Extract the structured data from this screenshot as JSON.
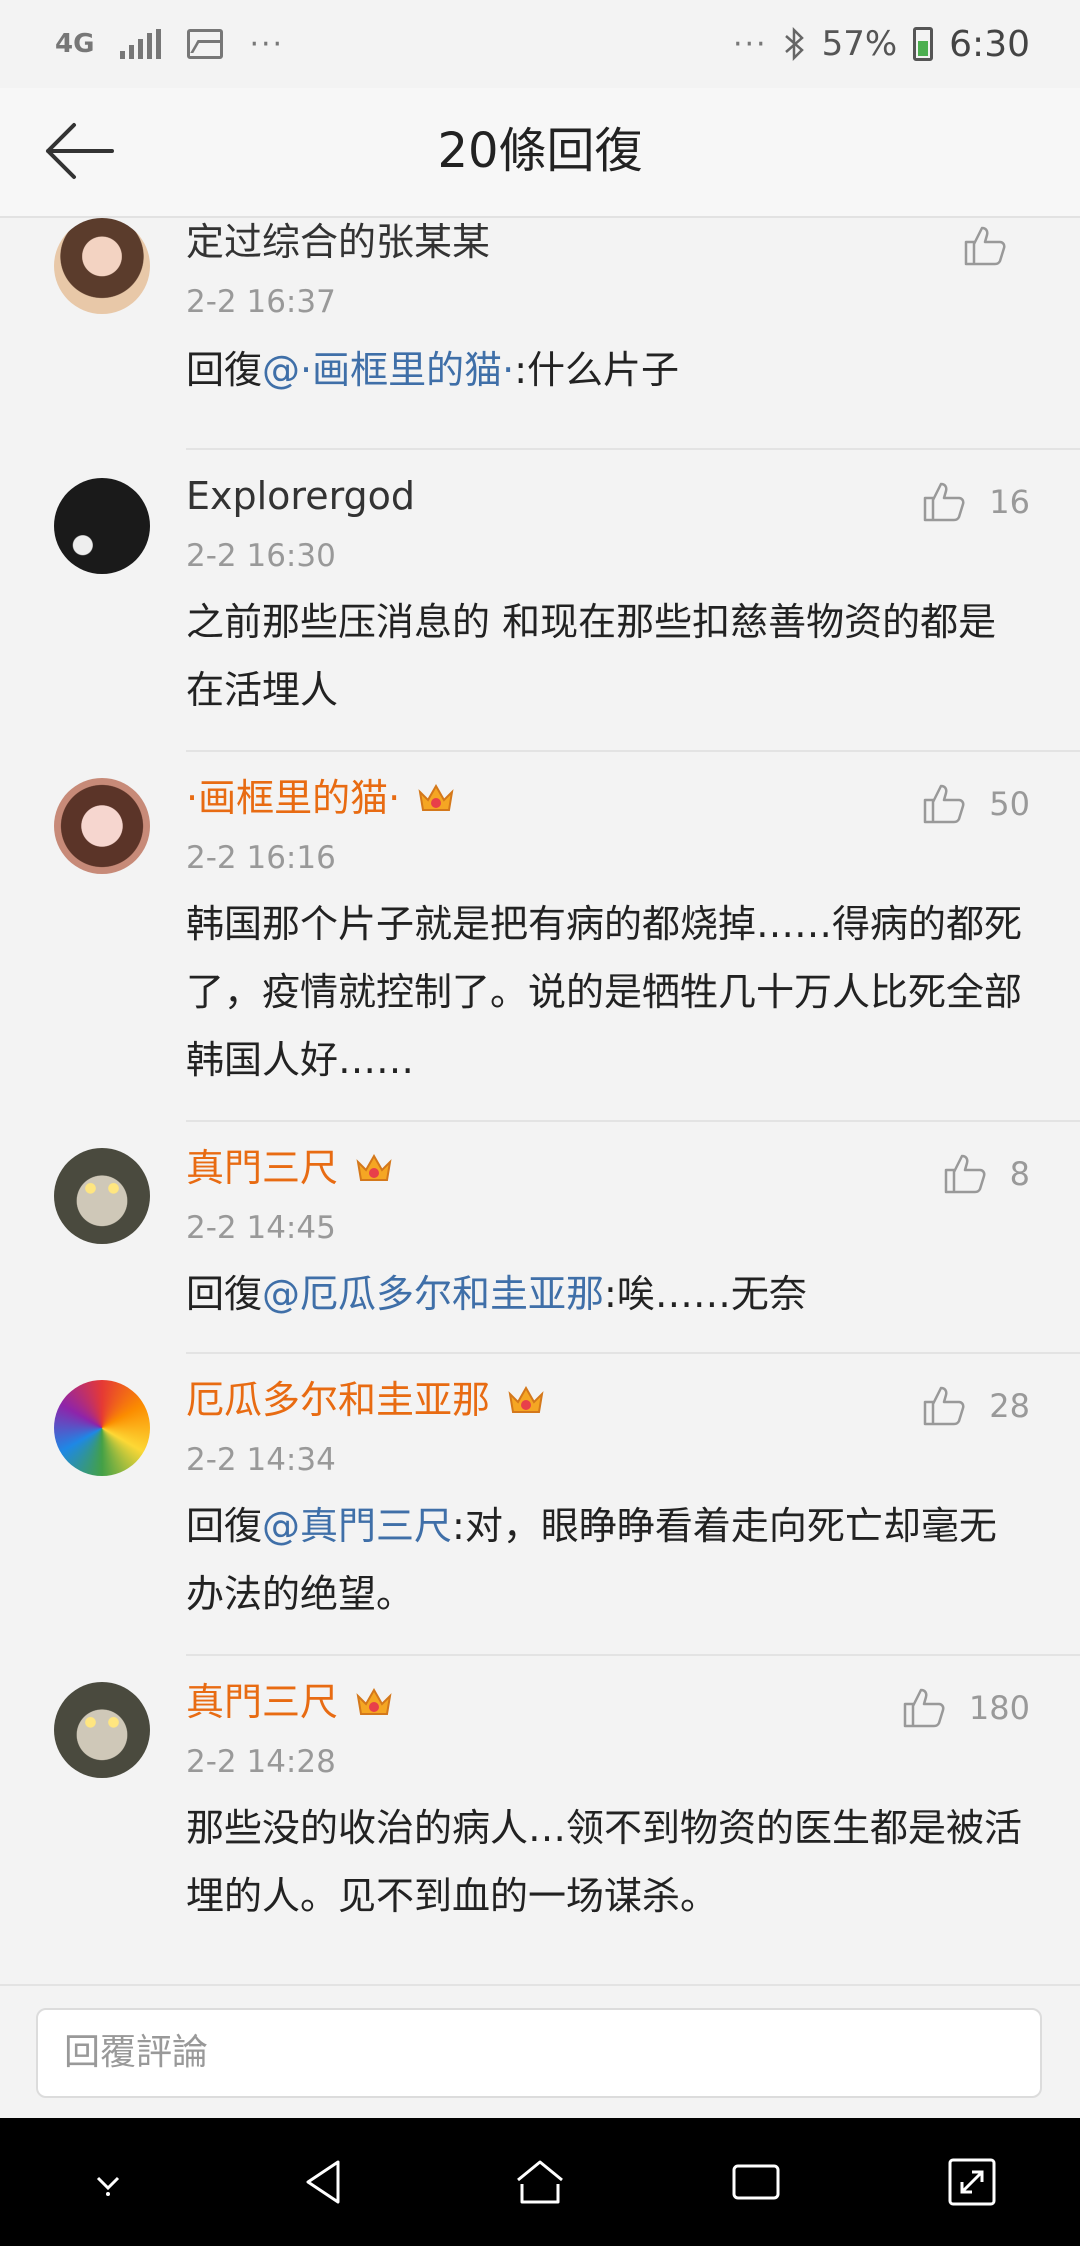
{
  "status_bar": {
    "network": "4G",
    "battery": "57%",
    "time": "6:30",
    "dots": "···",
    "more_dots": "···"
  },
  "header": {
    "title": "20條回復",
    "back_icon": "arrow-left-icon"
  },
  "comments": [
    {
      "name": "定过综合的张某某",
      "vip": false,
      "timestamp": "2-2 16:37",
      "likes": "",
      "reply_prefix": "回復",
      "mention": "@·画框里的猫·",
      "text": ":什么片子"
    },
    {
      "name": "Explorergod",
      "vip": false,
      "timestamp": "2-2 16:30",
      "likes": "16",
      "reply_prefix": "",
      "mention": "",
      "text": "之前那些压消息的 和现在那些扣慈善物资的都是在活埋人"
    },
    {
      "name": "·画框里的猫·",
      "vip": true,
      "timestamp": "2-2 16:16",
      "likes": "50",
      "reply_prefix": "",
      "mention": "",
      "text": "韩国那个片子就是把有病的都烧掉……得病的都死了，疫情就控制了。说的是牺牲几十万人比死全部韩国人好……"
    },
    {
      "name": "真門三尺",
      "vip": true,
      "timestamp": "2-2 14:45",
      "likes": "8",
      "reply_prefix": "回復",
      "mention": "@厄瓜多尔和圭亚那",
      "text": ":唉……无奈"
    },
    {
      "name": "厄瓜多尔和圭亚那",
      "vip": true,
      "timestamp": "2-2 14:34",
      "likes": "28",
      "reply_prefix": "回復",
      "mention": "@真門三尺",
      "text": ":对，眼睁睁看着走向死亡却毫无办法的绝望。"
    },
    {
      "name": "真門三尺",
      "vip": true,
      "timestamp": "2-2 14:28",
      "likes": "180",
      "reply_prefix": "",
      "mention": "",
      "text": "那些没的收治的病人…领不到物资的医生都是被活埋的人。见不到血的一场谋杀。"
    }
  ],
  "reply_bar": {
    "placeholder": "回覆評論"
  },
  "nav_bar": {
    "icons": [
      "chevron-down-icon",
      "back-triangle-icon",
      "home-icon",
      "recents-icon",
      "expand-icon"
    ]
  },
  "colors": {
    "vip_name": "#e86b12",
    "mention": "#3f6fa8",
    "muted": "#999999"
  }
}
